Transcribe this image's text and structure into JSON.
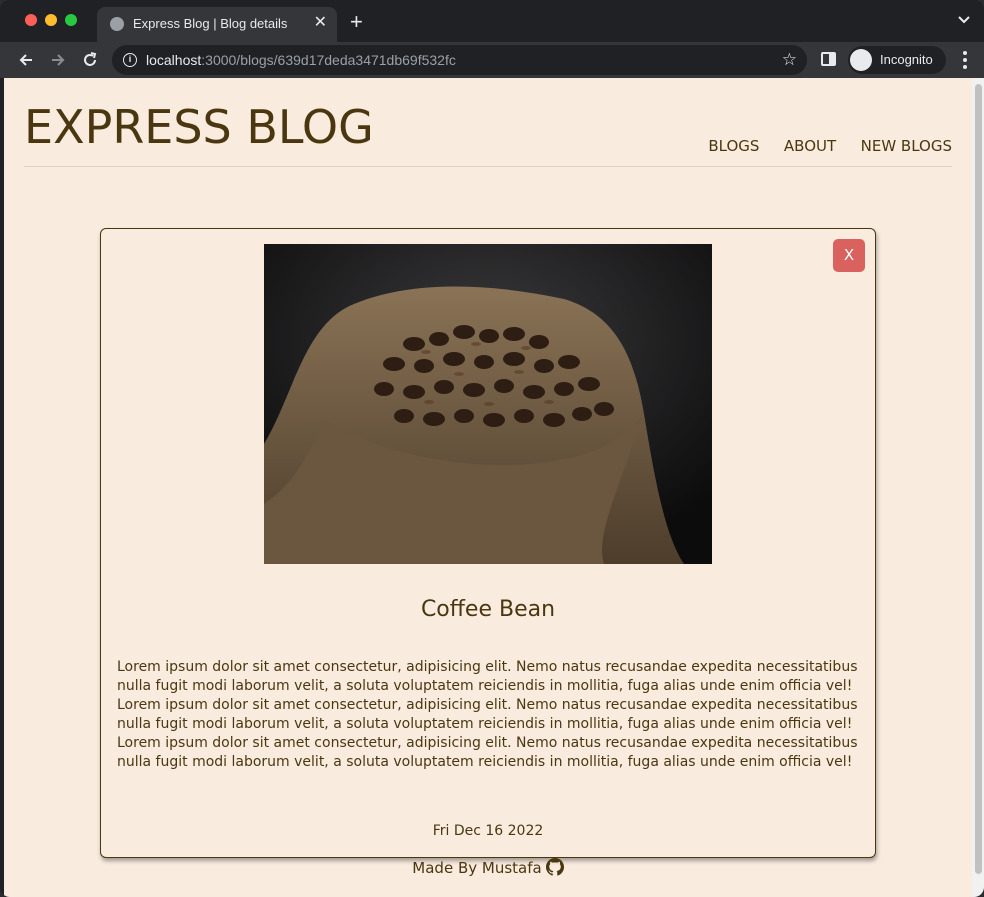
{
  "browser": {
    "tab": {
      "title": "Express Blog | Blog details",
      "close_label": "✕"
    },
    "new_tab_label": "+",
    "url": {
      "host": "localhost",
      "path": ":3000/blogs/639d17deda3471db69f532fc"
    },
    "profile_label": "Incognito"
  },
  "header": {
    "site_title": "EXPRESS BLOG",
    "nav": [
      "BLOGS",
      "ABOUT",
      "NEW BLOGS"
    ]
  },
  "blog": {
    "close_label": "X",
    "image_icon": "coffee-beans-photo",
    "title": "Coffee Bean",
    "body": "Lorem ipsum dolor sit amet consectetur, adipisicing elit. Nemo natus recusandae expedita necessitatibus nulla fugit modi laborum velit, a soluta voluptatem reiciendis in mollitia, fuga alias unde enim officia vel! Lorem ipsum dolor sit amet consectetur, adipisicing elit. Nemo natus recusandae expedita necessitatibus nulla fugit modi laborum velit, a soluta voluptatem reiciendis in mollitia, fuga alias unde enim officia vel! Lorem ipsum dolor sit amet consectetur, adipisicing elit. Nemo natus recusandae expedita necessitatibus nulla fugit modi laborum velit, a soluta voluptatem reiciendis in mollitia, fuga alias unde enim officia vel!",
    "date": "Fri Dec 16 2022"
  },
  "footer": {
    "text": "Made By Mustafa",
    "icon": "github-icon"
  },
  "colors": {
    "page_bg": "#f9ecdf",
    "text": "#4a3710",
    "close_button": "#d9625e"
  }
}
